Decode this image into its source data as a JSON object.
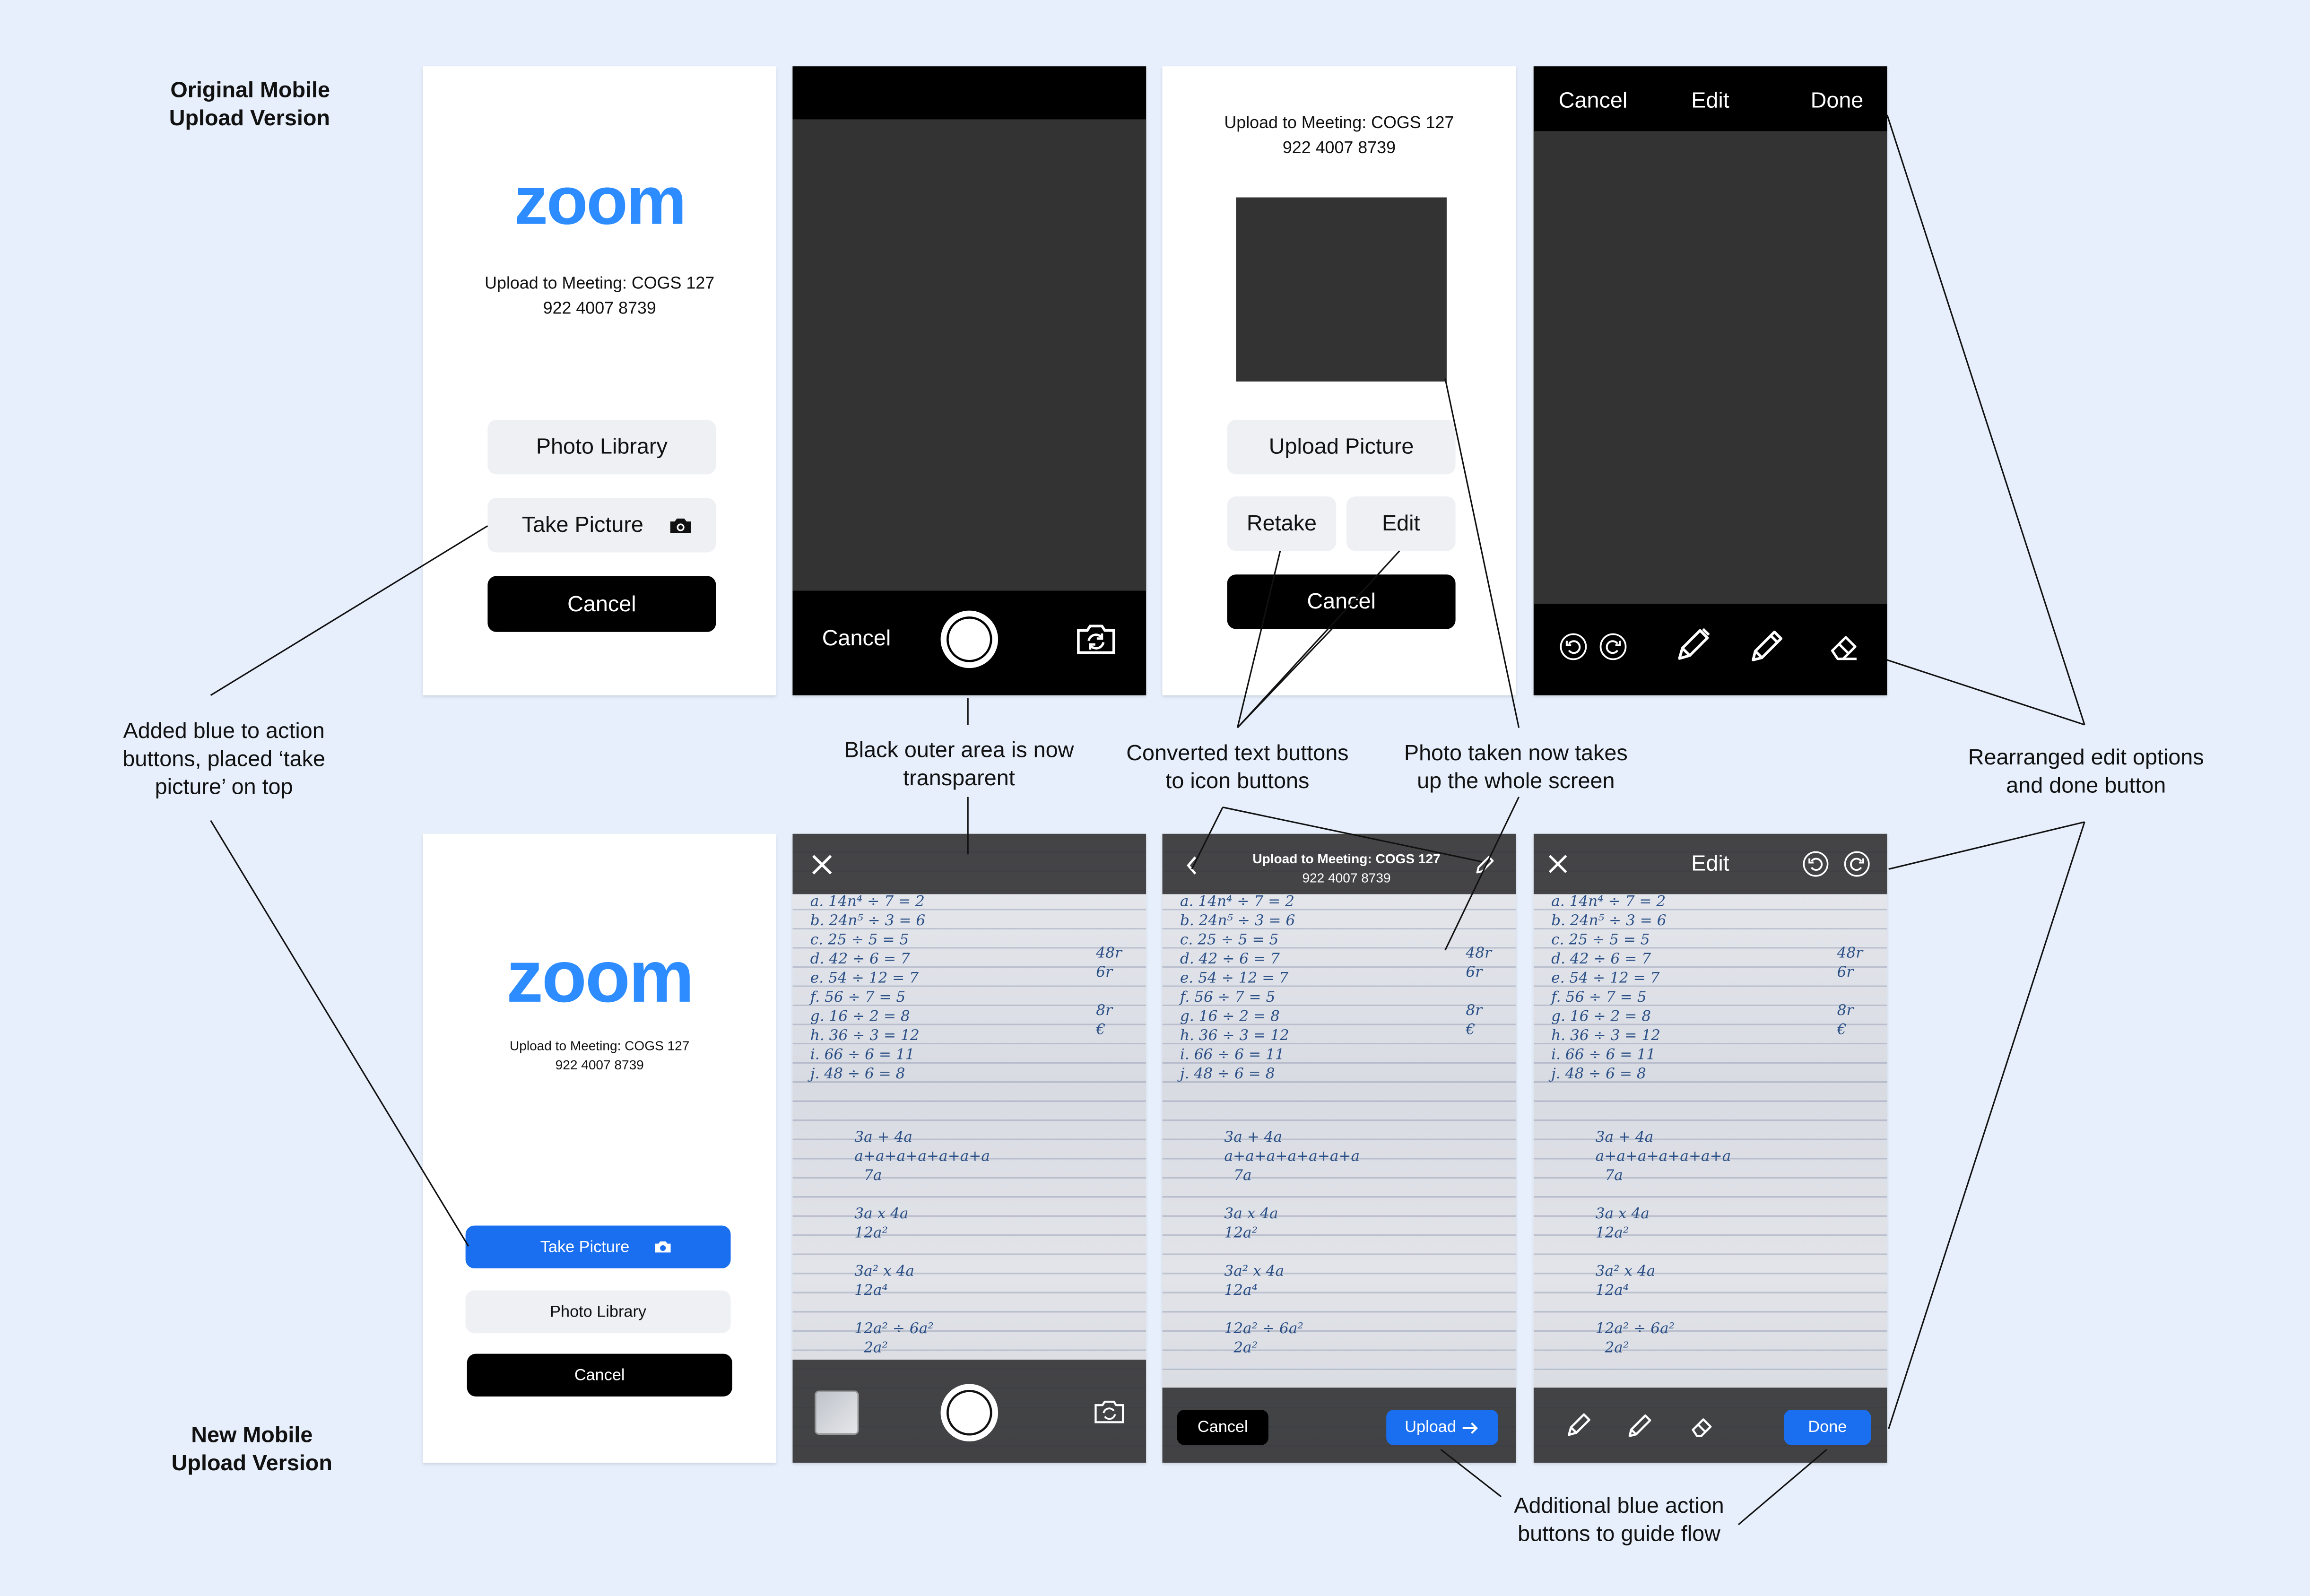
{
  "row_labels": {
    "original": [
      "Original Mobile",
      "Upload Version"
    ],
    "new": [
      "New Mobile",
      "Upload Version"
    ]
  },
  "original": {
    "screen1": {
      "logo": "zoom",
      "meeting_line1": "Upload to Meeting: COGS 127",
      "meeting_line2": "922 4007 8739",
      "photo_library": "Photo Library",
      "take_picture": "Take Picture",
      "cancel": "Cancel"
    },
    "screen2": {
      "cancel": "Cancel"
    },
    "screen3": {
      "meeting_line1": "Upload to Meeting: COGS 127",
      "meeting_line2": "922 4007 8739",
      "upload_picture": "Upload Picture",
      "retake": "Retake",
      "edit": "Edit",
      "cancel": "Cancel"
    },
    "screen4": {
      "cancel": "Cancel",
      "edit": "Edit",
      "done": "Done"
    }
  },
  "new": {
    "screen1": {
      "logo": "zoom",
      "meeting_line1": "Upload to Meeting: COGS 127",
      "meeting_line2": "922 4007 8739",
      "take_picture": "Take Picture",
      "photo_library": "Photo Library",
      "cancel": "Cancel"
    },
    "screen3": {
      "meeting_line1": "Upload to Meeting: COGS 127",
      "meeting_line2": "922 4007 8739",
      "cancel": "Cancel",
      "upload": "Upload"
    },
    "screen4": {
      "title": "Edit",
      "done": "Done"
    }
  },
  "annotations": {
    "blue_action": [
      "Added blue to action",
      "buttons, placed ‘take",
      "picture’ on top"
    ],
    "transparent": [
      "Black outer area is now",
      "transparent"
    ],
    "icon_buttons": [
      "Converted text buttons",
      "to icon buttons"
    ],
    "whole_screen": [
      "Photo taken now takes",
      "up the whole screen"
    ],
    "rearranged": [
      "Rearranged edit options",
      "and done button"
    ],
    "guide_flow": [
      "Additional blue action",
      "buttons to guide flow"
    ]
  },
  "colors": {
    "background": "#e6effb",
    "blue": "#1a6ef0",
    "zoom_blue": "#2d8cff",
    "dark": "#333333"
  },
  "icons": [
    "camera-icon",
    "flip-camera-icon",
    "shutter-icon",
    "close-icon",
    "back-chevron-icon",
    "pen-icon",
    "pencil-icon",
    "eraser-icon",
    "undo-icon",
    "redo-icon",
    "arrow-right-icon"
  ]
}
